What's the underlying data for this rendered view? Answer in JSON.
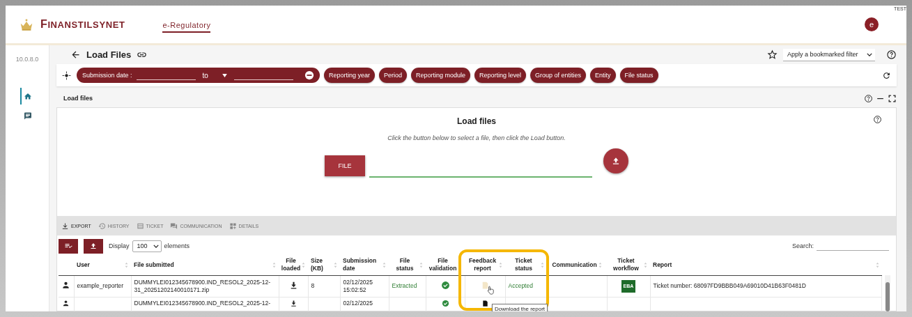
{
  "header": {
    "env_label": "TEST",
    "brand": "FINANSTILSYNET",
    "nav": [
      {
        "label": "e-Regulatory",
        "selected": true
      }
    ],
    "avatar": "e"
  },
  "sidebar": {
    "version": "10.0.8.0",
    "items": [
      {
        "kind": "home",
        "selected": true
      },
      {
        "kind": "messages",
        "selected": false
      }
    ]
  },
  "page": {
    "title": "Load Files",
    "bookmark_filter": "Apply a bookmarked filter"
  },
  "filters": {
    "date_label": "Submission date :",
    "date_to": "to",
    "chips": [
      "Reporting year",
      "Period",
      "Reporting module",
      "Reporting level",
      "Group of entities",
      "Entity",
      "File status"
    ]
  },
  "panel": {
    "title": "Load files",
    "heading": "Load files",
    "hint": "Click the button below to select a file, then click the Load button.",
    "file_button": "FILE"
  },
  "toolbar": [
    {
      "kind": "export",
      "label": "EXPORT",
      "disabled": false
    },
    {
      "kind": "history",
      "label": "HISTORY",
      "disabled": true
    },
    {
      "kind": "ticket",
      "label": "TICKET",
      "disabled": true
    },
    {
      "kind": "communication",
      "label": "COMMUNICATION",
      "disabled": true
    },
    {
      "kind": "details",
      "label": "DETAILS",
      "disabled": true
    }
  ],
  "table": {
    "display_label": "Display",
    "page_size": "100",
    "elements_label": "elements",
    "search_label": "Search:",
    "columns": [
      "",
      "User",
      "File submitted",
      "File loaded",
      "Size (KB)",
      "Submission date",
      "File status",
      "File validation",
      "Feedback report",
      "Ticket status",
      "Communication",
      "Ticket workflow",
      "Report"
    ],
    "rows": [
      {
        "user": "example_reporter",
        "file": "DUMMYLEI012345678900.IND_RESOL2_2025-12-31_20251202140010171.zip",
        "size": "8",
        "date": "02/12/2025 15:02:52",
        "file_status": {
          "text": "Extracted",
          "kind": "success"
        },
        "validation": {
          "kind": "ok"
        },
        "feedback": {
          "kind": "faded"
        },
        "ticket_status": {
          "text": "Accepted",
          "kind": "success"
        },
        "workflow": "EBA",
        "report": "Ticket number: 68097FD9BBB049A69010D41B63F0481D"
      },
      {
        "file": "DUMMYLEI012345678900.IND_RESOL2_2025-12-",
        "date": "02/12/2025",
        "validation": {
          "kind": "ok"
        },
        "feedback": {
          "kind": "dark"
        }
      }
    ]
  },
  "tooltip": "Download the report"
}
